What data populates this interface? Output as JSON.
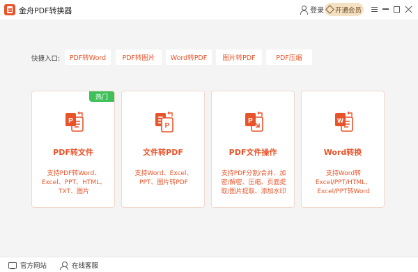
{
  "app": {
    "title": "金舟PDF转换器",
    "logo_icon": "app-logo-icon"
  },
  "header": {
    "login_label": "登录",
    "vip_label": "开通会员"
  },
  "quick_entry": {
    "label": "快捷入口:",
    "items": [
      "PDF转Word",
      "PDF转图片",
      "Word转PDF",
      "图片转PDF",
      "PDF压缩"
    ]
  },
  "cards": [
    {
      "title": "PDF转文件",
      "desc": "支持PDF转Word、Excel、PPT、HTML、TXT、图片",
      "badge": "热门",
      "icon": "pdf-to-file-icon"
    },
    {
      "title": "文件转PDF",
      "desc": "支持Word、Excel、PPT、图片转PDF",
      "icon": "file-to-pdf-icon"
    },
    {
      "title": "PDF文件操作",
      "desc": "支持PDF分割/合并、加密/解密、压缩、页面提取/图片提取、添加水印",
      "icon": "pdf-operation-icon"
    },
    {
      "title": "Word转换",
      "desc": "支持Word转Excel/PPT/HTML、Excel/PPT转Word",
      "icon": "word-convert-icon"
    }
  ],
  "footer": {
    "website_label": "官方网站",
    "service_label": "在线客服"
  },
  "colors": {
    "accent": "#e8542a",
    "badge": "#3fc05a",
    "vip_bg": "#f4e1c4"
  }
}
